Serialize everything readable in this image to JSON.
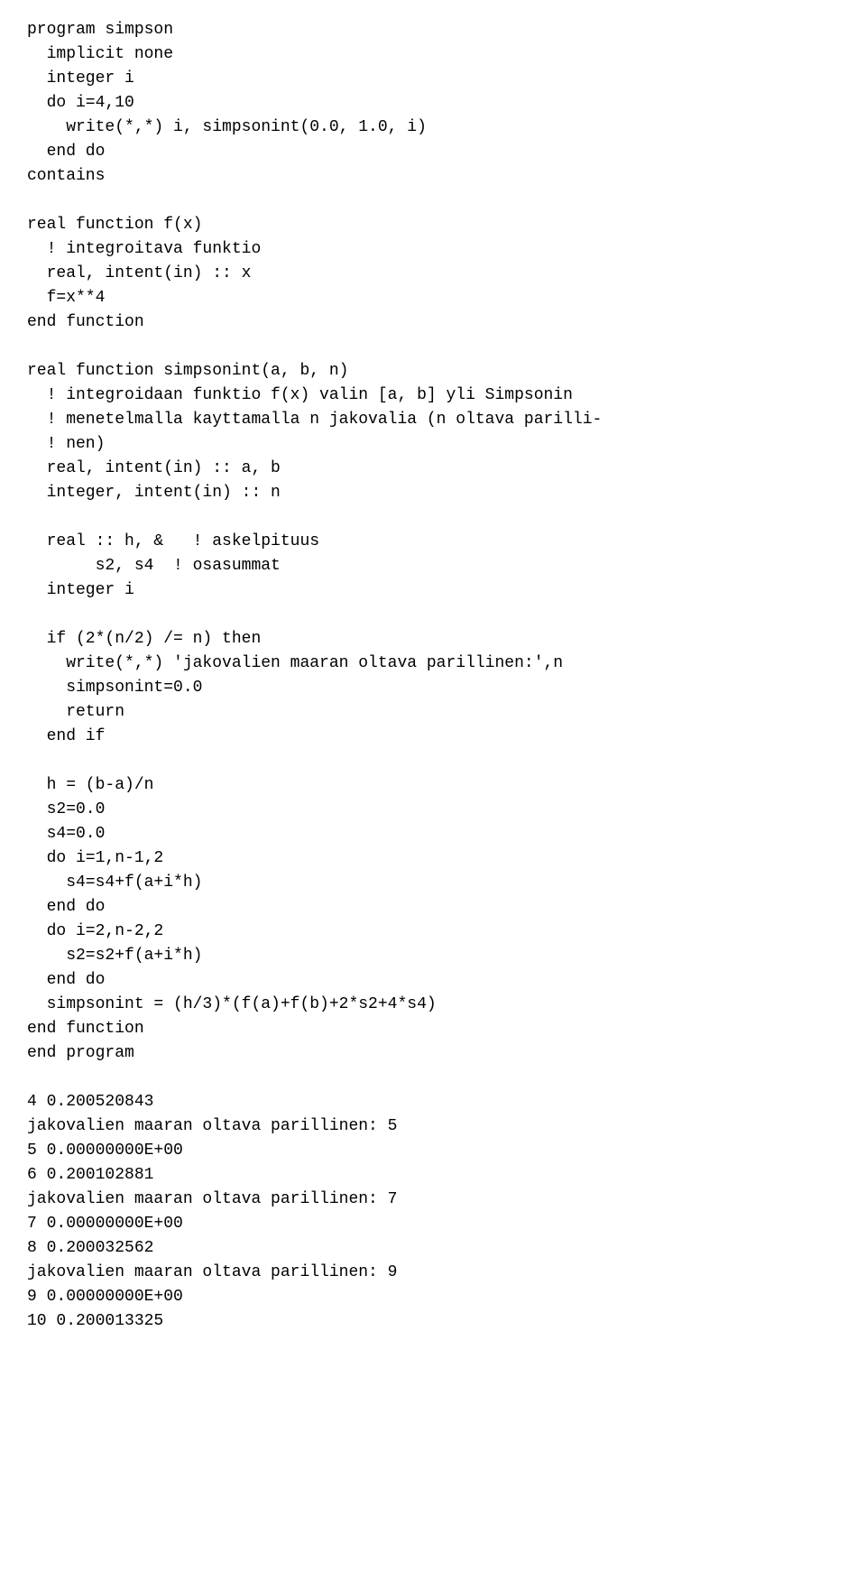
{
  "code": {
    "lines": [
      "program simpson",
      "  implicit none",
      "  integer i",
      "  do i=4,10",
      "    write(*,*) i, simpsonint(0.0, 1.0, i)",
      "  end do",
      "contains",
      "",
      "real function f(x)",
      "  ! integroitava funktio",
      "  real, intent(in) :: x",
      "  f=x**4",
      "end function",
      "",
      "real function simpsonint(a, b, n)",
      "  ! integroidaan funktio f(x) valin [a, b] yli Simpsonin",
      "  ! menetelmalla kayttamalla n jakovalia (n oltava parilli-",
      "  ! nen)",
      "  real, intent(in) :: a, b",
      "  integer, intent(in) :: n",
      "",
      "  real :: h, &   ! askelpituus",
      "       s2, s4  ! osasummat",
      "  integer i",
      "",
      "  if (2*(n/2) /= n) then",
      "    write(*,*) 'jakovalien maaran oltava parillinen:',n",
      "    simpsonint=0.0",
      "    return",
      "  end if",
      "",
      "  h = (b-a)/n",
      "  s2=0.0",
      "  s4=0.0",
      "  do i=1,n-1,2",
      "    s4=s4+f(a+i*h)",
      "  end do",
      "  do i=2,n-2,2",
      "    s2=s2+f(a+i*h)",
      "  end do",
      "  simpsonint = (h/3)*(f(a)+f(b)+2*s2+4*s4)",
      "end function",
      "end program",
      "",
      "4 0.200520843",
      "jakovalien maaran oltava parillinen: 5",
      "5 0.00000000E+00",
      "6 0.200102881",
      "jakovalien maaran oltava parillinen: 7",
      "7 0.00000000E+00",
      "8 0.200032562",
      "jakovalien maaran oltava parillinen: 9",
      "9 0.00000000E+00",
      "10 0.200013325"
    ]
  }
}
